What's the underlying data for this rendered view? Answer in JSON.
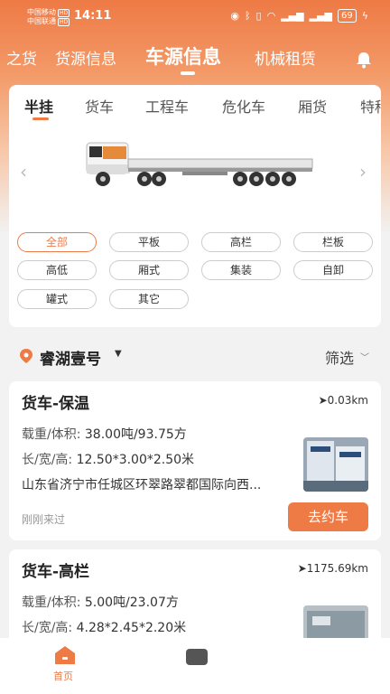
{
  "status_bar": {
    "carrier1": "中国移动",
    "carrier2": "中国联通",
    "hd": "HD",
    "time": "14:11",
    "battery": "69"
  },
  "top_nav": {
    "items": [
      {
        "label": "之货"
      },
      {
        "label": "货源信息"
      },
      {
        "label": "车源信息"
      },
      {
        "label": "机械租赁"
      }
    ]
  },
  "category_tabs": [
    {
      "label": "半挂"
    },
    {
      "label": "货车"
    },
    {
      "label": "工程车"
    },
    {
      "label": "危化车"
    },
    {
      "label": "厢货"
    },
    {
      "label": "特种"
    }
  ],
  "truck_types": [
    {
      "label": "全部"
    },
    {
      "label": "平板"
    },
    {
      "label": "高栏"
    },
    {
      "label": "栏板"
    },
    {
      "label": "高低"
    },
    {
      "label": "厢式"
    },
    {
      "label": "集装"
    },
    {
      "label": "自卸"
    },
    {
      "label": "罐式"
    },
    {
      "label": "其它"
    }
  ],
  "location": {
    "name": "睿湖壹号",
    "filter_label": "筛选"
  },
  "listings": [
    {
      "title": "货车-保温",
      "distance": "0.03km",
      "load_label": "载重/体积:",
      "load_value": "38.00吨/93.75方",
      "size_label": "长/宽/高:",
      "size_value": "12.50*3.00*2.50米",
      "address": "山东省济宁市任城区环翠路翠都国际向西...",
      "time": "刚刚来过",
      "button": "去约车"
    },
    {
      "title": "货车-高栏",
      "distance": "1175.69km",
      "load_label": "载重/体积:",
      "load_value": "5.00吨/23.07方",
      "size_label": "长/宽/高:",
      "size_value": "4.28*2.45*2.20米"
    }
  ],
  "bottom_nav": {
    "home_label": "首页"
  },
  "colors": {
    "accent": "#ee7a45"
  }
}
